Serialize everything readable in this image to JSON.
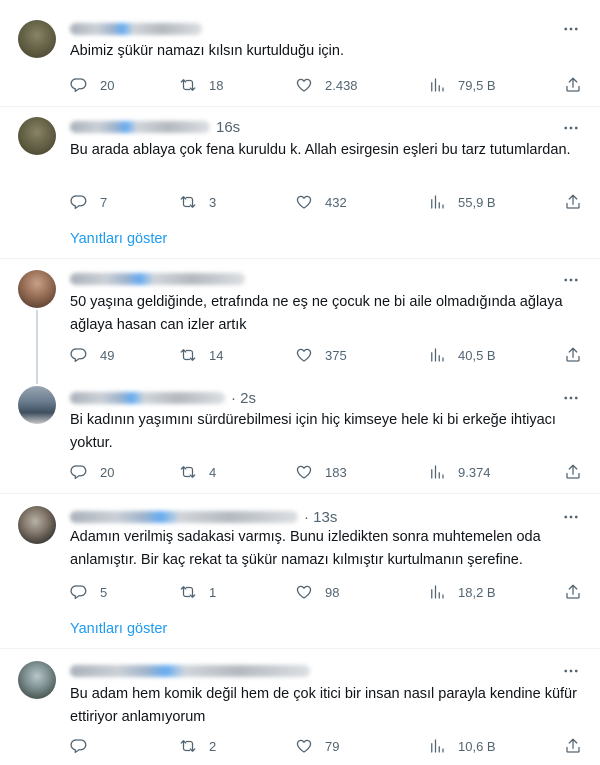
{
  "show_replies_label": "Yanıtları göster",
  "tweets": [
    {
      "time": "",
      "text": "Abimiz şükür namazı kılsın kurtulduğu için.",
      "replies": "20",
      "retweets": "18",
      "likes": "2.438",
      "views": "79,5 B"
    },
    {
      "time": "16s",
      "text": "Bu arada ablaya çok fena kuruldu k. Allah esirgesin eşleri bu tarz tutumlardan.",
      "replies": "7",
      "retweets": "3",
      "likes": "432",
      "views": "55,9 B"
    },
    {
      "time": "",
      "text": "50 yaşına geldiğinde, etrafında ne eş ne çocuk ne bi aile olmadığında ağlaya ağlaya hasan can izler artık",
      "replies": "49",
      "retweets": "14",
      "likes": "375",
      "views": "40,5 B"
    },
    {
      "time": "· 2s",
      "text": "Bi kadının yaşımını sürdürebilmesi için hiç kimseye hele ki bi erkeğe ihtiyacı yoktur.",
      "replies": "20",
      "retweets": "4",
      "likes": "183",
      "views": "9.374"
    },
    {
      "time": "· 13s",
      "text": "Adamın verilmiş sadakasi varmış. Bunu izledikten sonra muhtemelen oda anlamıştır. Bir kaç rekat ta şükür namazı kılmıştır kurtulmanın şerefine.",
      "replies": "5",
      "retweets": "1",
      "likes": "98",
      "views": "18,2 B"
    },
    {
      "time": "",
      "text": "Bu adam hem komik değil hem de çok itici bir insan nasıl parayla kendine küfür ettiriyor anlamıyorum",
      "replies": "",
      "retweets": "2",
      "likes": "79",
      "views": "10,6 B"
    }
  ],
  "icons": [
    "more-icon",
    "reply-icon",
    "retweet-icon",
    "like-icon",
    "views-icon",
    "share-icon"
  ],
  "colors": {
    "text": "#0f1419",
    "muted": "#536471",
    "link": "#1d9bf0",
    "divider": "#eff3f4"
  }
}
